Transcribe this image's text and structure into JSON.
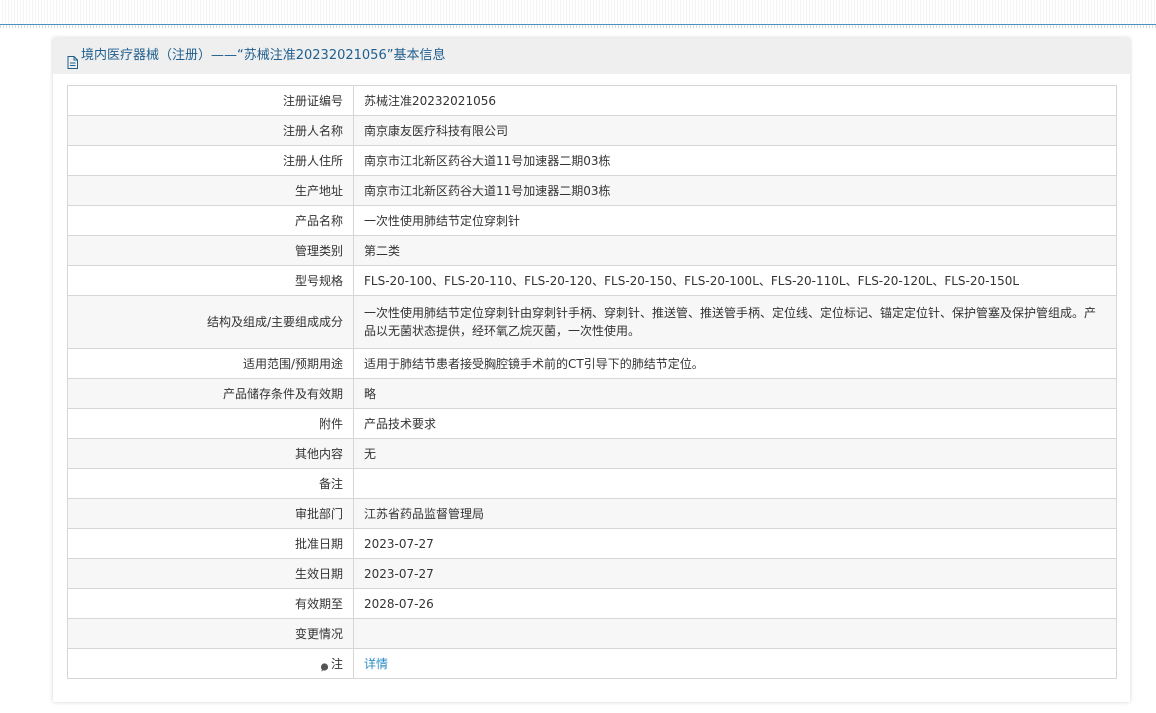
{
  "header": {
    "title": "境内医疗器械（注册）——“苏械注准20232021056”基本信息"
  },
  "rows": [
    {
      "label": "注册证编号",
      "value": "苏械注准20232021056"
    },
    {
      "label": "注册人名称",
      "value": "南京康友医疗科技有限公司"
    },
    {
      "label": "注册人住所",
      "value": "南京市江北新区药谷大道11号加速器二期03栋"
    },
    {
      "label": "生产地址",
      "value": "南京市江北新区药谷大道11号加速器二期03栋"
    },
    {
      "label": "产品名称",
      "value": "一次性使用肺结节定位穿刺针"
    },
    {
      "label": "管理类别",
      "value": "第二类"
    },
    {
      "label": "型号规格",
      "value": "FLS-20-100、FLS-20-110、FLS-20-120、FLS-20-150、FLS-20-100L、FLS-20-110L、FLS-20-120L、FLS-20-150L"
    },
    {
      "label": "结构及组成/主要组成成分",
      "value": "一次性使用肺结节定位穿刺针由穿刺针手柄、穿刺针、推送管、推送管手柄、定位线、定位标记、锚定定位针、保护管塞及保护管组成。产品以无菌状态提供，经环氧乙烷灭菌，一次性使用。"
    },
    {
      "label": "适用范围/预期用途",
      "value": "适用于肺结节患者接受胸腔镜手术前的CT引导下的肺结节定位。"
    },
    {
      "label": "产品储存条件及有效期",
      "value": "略"
    },
    {
      "label": "附件",
      "value": "产品技术要求"
    },
    {
      "label": "其他内容",
      "value": "无"
    },
    {
      "label": "备注",
      "value": ""
    },
    {
      "label": "审批部门",
      "value": "江苏省药品监督管理局"
    },
    {
      "label": "批准日期",
      "value": "2023-07-27"
    },
    {
      "label": "生效日期",
      "value": "2023-07-27"
    },
    {
      "label": "有效期至",
      "value": "2028-07-26"
    },
    {
      "label": "变更情况",
      "value": ""
    }
  ],
  "note_row": {
    "label": "注",
    "link_text": "详情"
  },
  "icons": {
    "header": "document-icon",
    "note": "pin-icon"
  },
  "colors": {
    "header_text": "#1f5f8f",
    "link": "#2b8cc4",
    "top_line": "#4a90c2"
  }
}
